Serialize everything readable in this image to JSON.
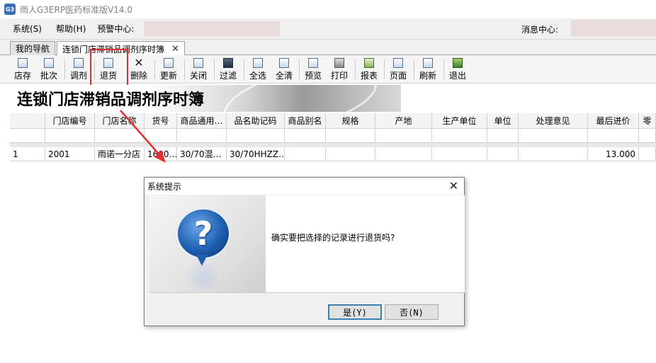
{
  "window": {
    "title": "雨人G3ERP医药标准版V14.0",
    "icon_label": "G3"
  },
  "menubar": {
    "items": [
      "系统(S)",
      "帮助(H)"
    ],
    "alert_label": "预警中心:",
    "message_label": "消息中心:"
  },
  "tabs": [
    {
      "label": "我的导航",
      "active": false
    },
    {
      "label": "连锁门店滞销品调剂序时簿",
      "active": true,
      "close": "✕"
    }
  ],
  "toolbar": {
    "buttons": [
      {
        "label": "店存",
        "icon": "list-icon"
      },
      {
        "label": "批次",
        "icon": "list-icon"
      },
      {
        "label": "调剂",
        "icon": "list-icon"
      },
      {
        "label": "退货",
        "icon": "list-icon"
      },
      {
        "label": "删除",
        "icon": "close-icon"
      },
      {
        "label": "更新",
        "icon": "list-icon"
      },
      {
        "label": "关闭",
        "icon": "list-icon"
      },
      {
        "label": "过滤",
        "icon": "binoculars-icon"
      },
      {
        "label": "全选",
        "icon": "list-icon"
      },
      {
        "label": "全清",
        "icon": "list-icon"
      },
      {
        "label": "预览",
        "icon": "preview-icon"
      },
      {
        "label": "打印",
        "icon": "printer-icon"
      },
      {
        "label": "报表",
        "icon": "report-icon"
      },
      {
        "label": "页面",
        "icon": "page-icon"
      },
      {
        "label": "刷新",
        "icon": "refresh-icon"
      },
      {
        "label": "退出",
        "icon": "exit-icon"
      }
    ]
  },
  "banner": {
    "heading": "连锁门店滞销品调剂序时簿"
  },
  "table": {
    "columns": [
      "",
      "门店编号",
      "门店名称",
      "货号",
      "商品通用…",
      "品名助记码",
      "商品别名",
      "规格",
      "产地",
      "生产单位",
      "单位",
      "处理意见",
      "最后进价",
      "零"
    ],
    "rows": [
      [
        "1",
        "2001",
        "雨诺一分店",
        "1600…",
        "30/70混…",
        "30/70HHZZ…",
        "",
        "",
        "",
        "",
        "",
        "",
        "13.000",
        ""
      ]
    ]
  },
  "dialog": {
    "title": "系统提示",
    "close": "✕",
    "message": "确实要把选择的记录进行退货吗?",
    "icon_glyph": "?",
    "yes_label": "是(Y)",
    "no_label": "否(N)"
  },
  "colors": {
    "highlight": "#e03030",
    "accent": "#3c7fb1"
  }
}
